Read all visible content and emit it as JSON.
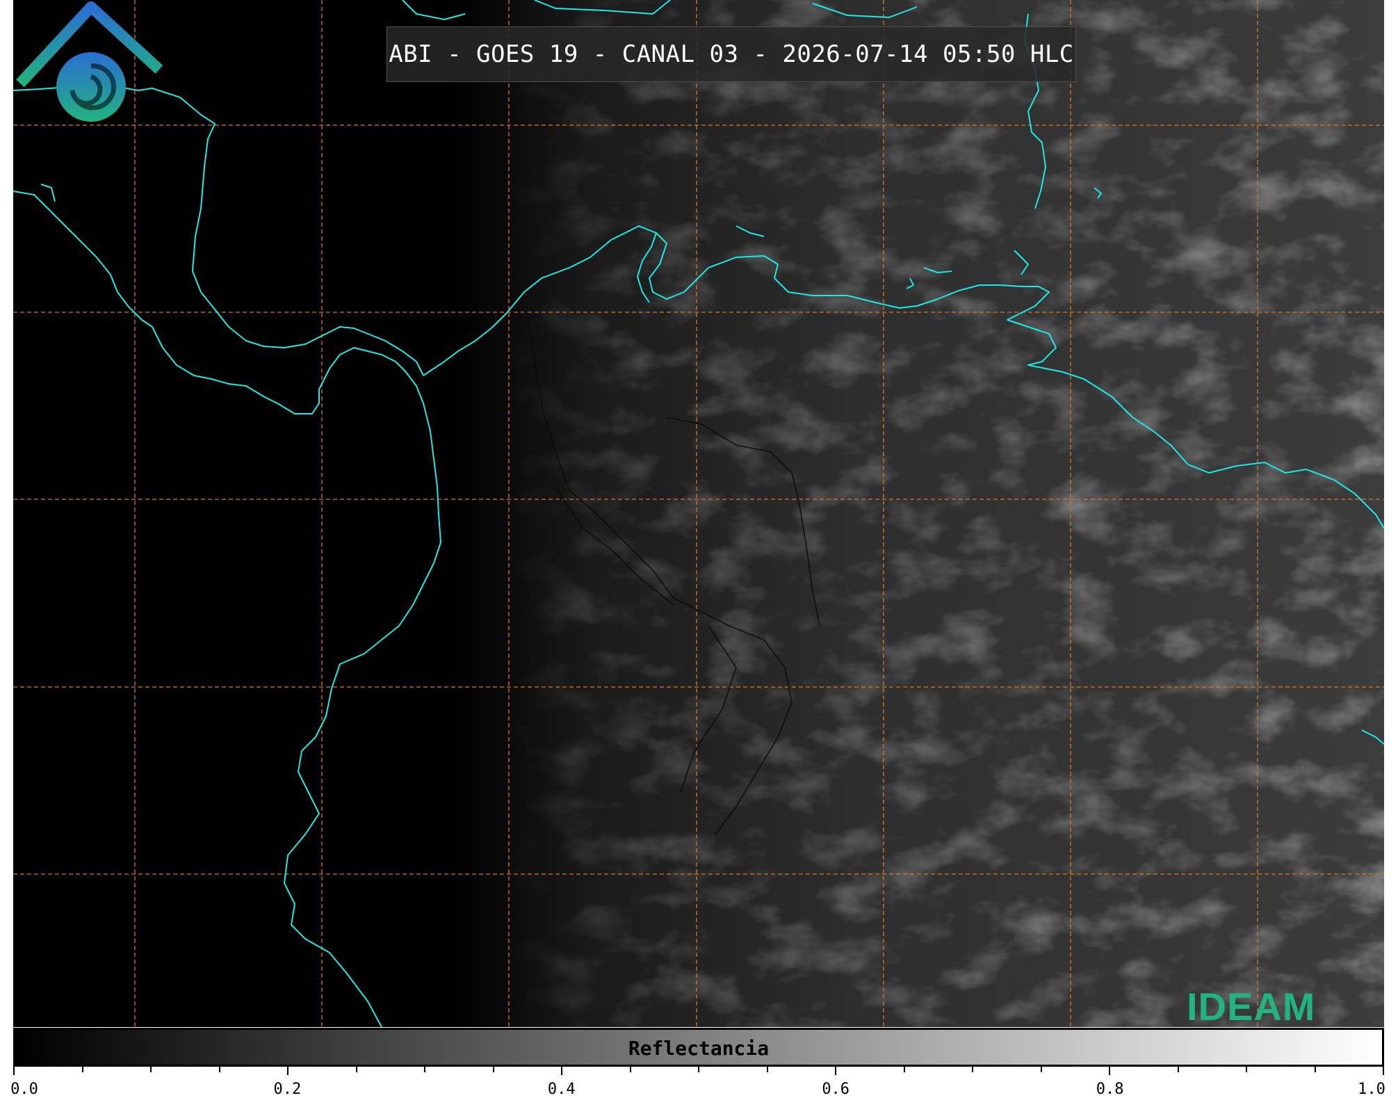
{
  "title": "ABI - GOES 19 - CANAL 03 - 2026-07-14 05:50 HLC",
  "logo_text": "IDEAM",
  "colorbar": {
    "label": "Reflectancia",
    "min": 0.0,
    "max": 1.0,
    "tick_labels": [
      "0.0",
      "0.2",
      "0.4",
      "0.6",
      "0.8",
      "1.0"
    ],
    "colors": [
      "#000000",
      "#ffffff"
    ]
  },
  "colors": {
    "coastline": "#1de9e6",
    "gridline": "#d9782d",
    "logo_blue": "#2a6fd1",
    "logo_green": "#22b37f"
  }
}
